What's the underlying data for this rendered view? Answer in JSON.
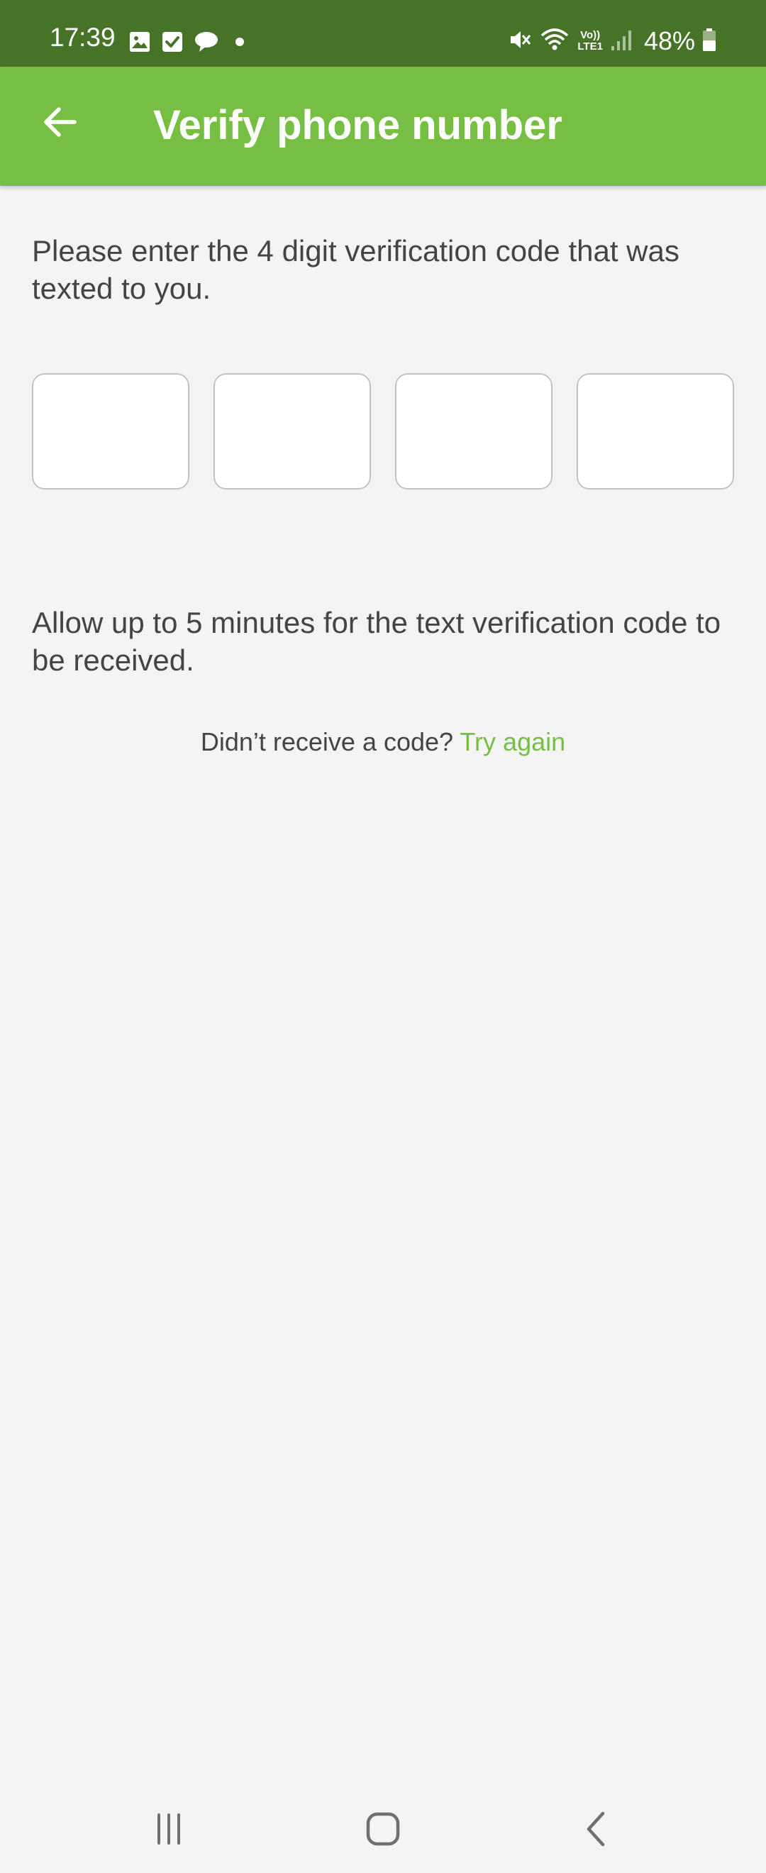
{
  "status_bar": {
    "time": "17:39",
    "battery_percent": "48%",
    "left_icons": [
      "gallery-icon",
      "checkbox-icon",
      "chat-bubble-icon",
      "dot-icon"
    ],
    "right_icons": [
      "mute-icon",
      "wifi-icon",
      "volte-lte-icon",
      "signal-icon",
      "battery-icon"
    ],
    "volte_label_top": "Vo))",
    "volte_label_bottom": "LTE1",
    "background_color": "#467327"
  },
  "app_bar": {
    "title": "Verify phone number",
    "back_icon": "arrow-left-icon",
    "background_color": "#76bf43"
  },
  "instruction": "Please enter the 4 digit verification code that was texted to you.",
  "code_inputs": [
    "",
    "",
    "",
    ""
  ],
  "allow_text": "Allow up to 5 minutes for the text verification code to be received.",
  "retry": {
    "prompt": "Didn’t receive a code?",
    "link_label": "Try again",
    "link_color": "#76bf43"
  },
  "nav_bar": {
    "buttons": [
      "recent-apps-icon",
      "home-icon",
      "back-icon"
    ]
  }
}
